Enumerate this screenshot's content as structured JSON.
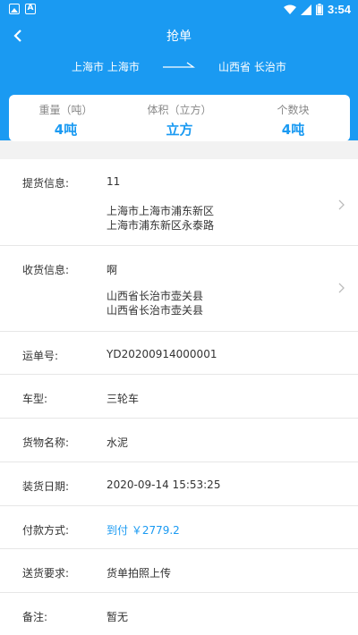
{
  "status_bar": {
    "time": "3:54"
  },
  "header": {
    "title": "抢单",
    "route": {
      "from": "上海市 上海市",
      "to": "山西省 长治市"
    }
  },
  "summary": [
    {
      "label": "重量（吨）",
      "value": "4吨"
    },
    {
      "label": "体积（立方）",
      "value": "立方"
    },
    {
      "label": "个数块",
      "value": "4吨"
    }
  ],
  "details": {
    "pickup": {
      "label": "提货信息:",
      "name": "11",
      "address_line1": "上海市上海市浦东新区",
      "address_line2": "上海市浦东新区永泰路"
    },
    "delivery": {
      "label": "收货信息:",
      "name": "啊",
      "address_line1": "山西省长治市壶关县",
      "address_line2": "山西省长治市壶关县"
    },
    "waybill": {
      "label": "运单号:",
      "value": "YD20200914000001"
    },
    "vehicle": {
      "label": "车型:",
      "value": "三轮车"
    },
    "cargo": {
      "label": "货物名称:",
      "value": "水泥"
    },
    "load_date": {
      "label": "装货日期:",
      "value": "2020-09-14 15:53:25"
    },
    "payment": {
      "label": "付款方式:",
      "value": "到付 ￥2779.2"
    },
    "requirement": {
      "label": "送货要求:",
      "value": "货单拍照上传"
    },
    "remark": {
      "label": "备注:",
      "value": "暂无"
    }
  },
  "colors": {
    "primary": "#1a9af2",
    "text": "#333333",
    "muted": "#888888"
  }
}
